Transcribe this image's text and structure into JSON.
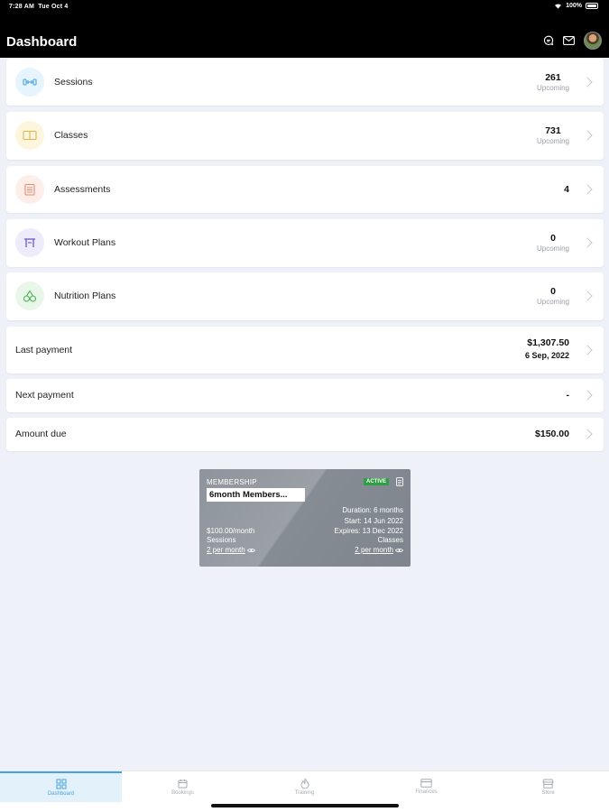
{
  "status": {
    "time": "7:28 AM",
    "date": "Tue Oct 4",
    "battery": "100%"
  },
  "header": {
    "title": "Dashboard"
  },
  "rows": [
    {
      "label": "Sessions",
      "value": "261",
      "sub": "Upcoming",
      "icon": "dumbbell-icon",
      "color": "#4aa3df",
      "bg": "#e6f4fd"
    },
    {
      "label": "Classes",
      "value": "731",
      "sub": "Upcoming",
      "icon": "board-icon",
      "color": "#e0b64a",
      "bg": "#fdf6df"
    },
    {
      "label": "Assessments",
      "value": "4",
      "sub": "",
      "icon": "clipboard-icon",
      "color": "#e88a6d",
      "bg": "#fdeee9"
    },
    {
      "label": "Workout Plans",
      "value": "0",
      "sub": "Upcoming",
      "icon": "kettlebell-icon",
      "color": "#6a5acd",
      "bg": "#eeecfb"
    },
    {
      "label": "Nutrition Plans",
      "value": "0",
      "sub": "Upcoming",
      "icon": "cherries-icon",
      "color": "#4caf50",
      "bg": "#e9f6ea"
    }
  ],
  "payments": {
    "last_label": "Last payment",
    "last_amount": "$1,307.50",
    "last_date": "6 Sep, 2022",
    "next_label": "Next payment",
    "next_value": "-",
    "due_label": "Amount due",
    "due_value": "$150.00"
  },
  "membership": {
    "label": "MEMBERSHIP",
    "badge": "ACTIVE",
    "name": "6month Members...",
    "duration": "Duration: 6 months",
    "start": "Start: 14 Jun 2022",
    "expires": "Expires: 13 Dec 2022",
    "price": "$100.00/month",
    "sessions_label": "Sessions",
    "sessions_value": "2 per month",
    "classes_label": "Classes",
    "classes_value": "2 per month"
  },
  "tabs": [
    {
      "label": "Dashboard",
      "icon": "dashboard-icon"
    },
    {
      "label": "Bookings",
      "icon": "calendar-icon"
    },
    {
      "label": "Training",
      "icon": "flame-icon"
    },
    {
      "label": "Finances",
      "icon": "card-icon"
    },
    {
      "label": "Store",
      "icon": "store-icon"
    }
  ]
}
